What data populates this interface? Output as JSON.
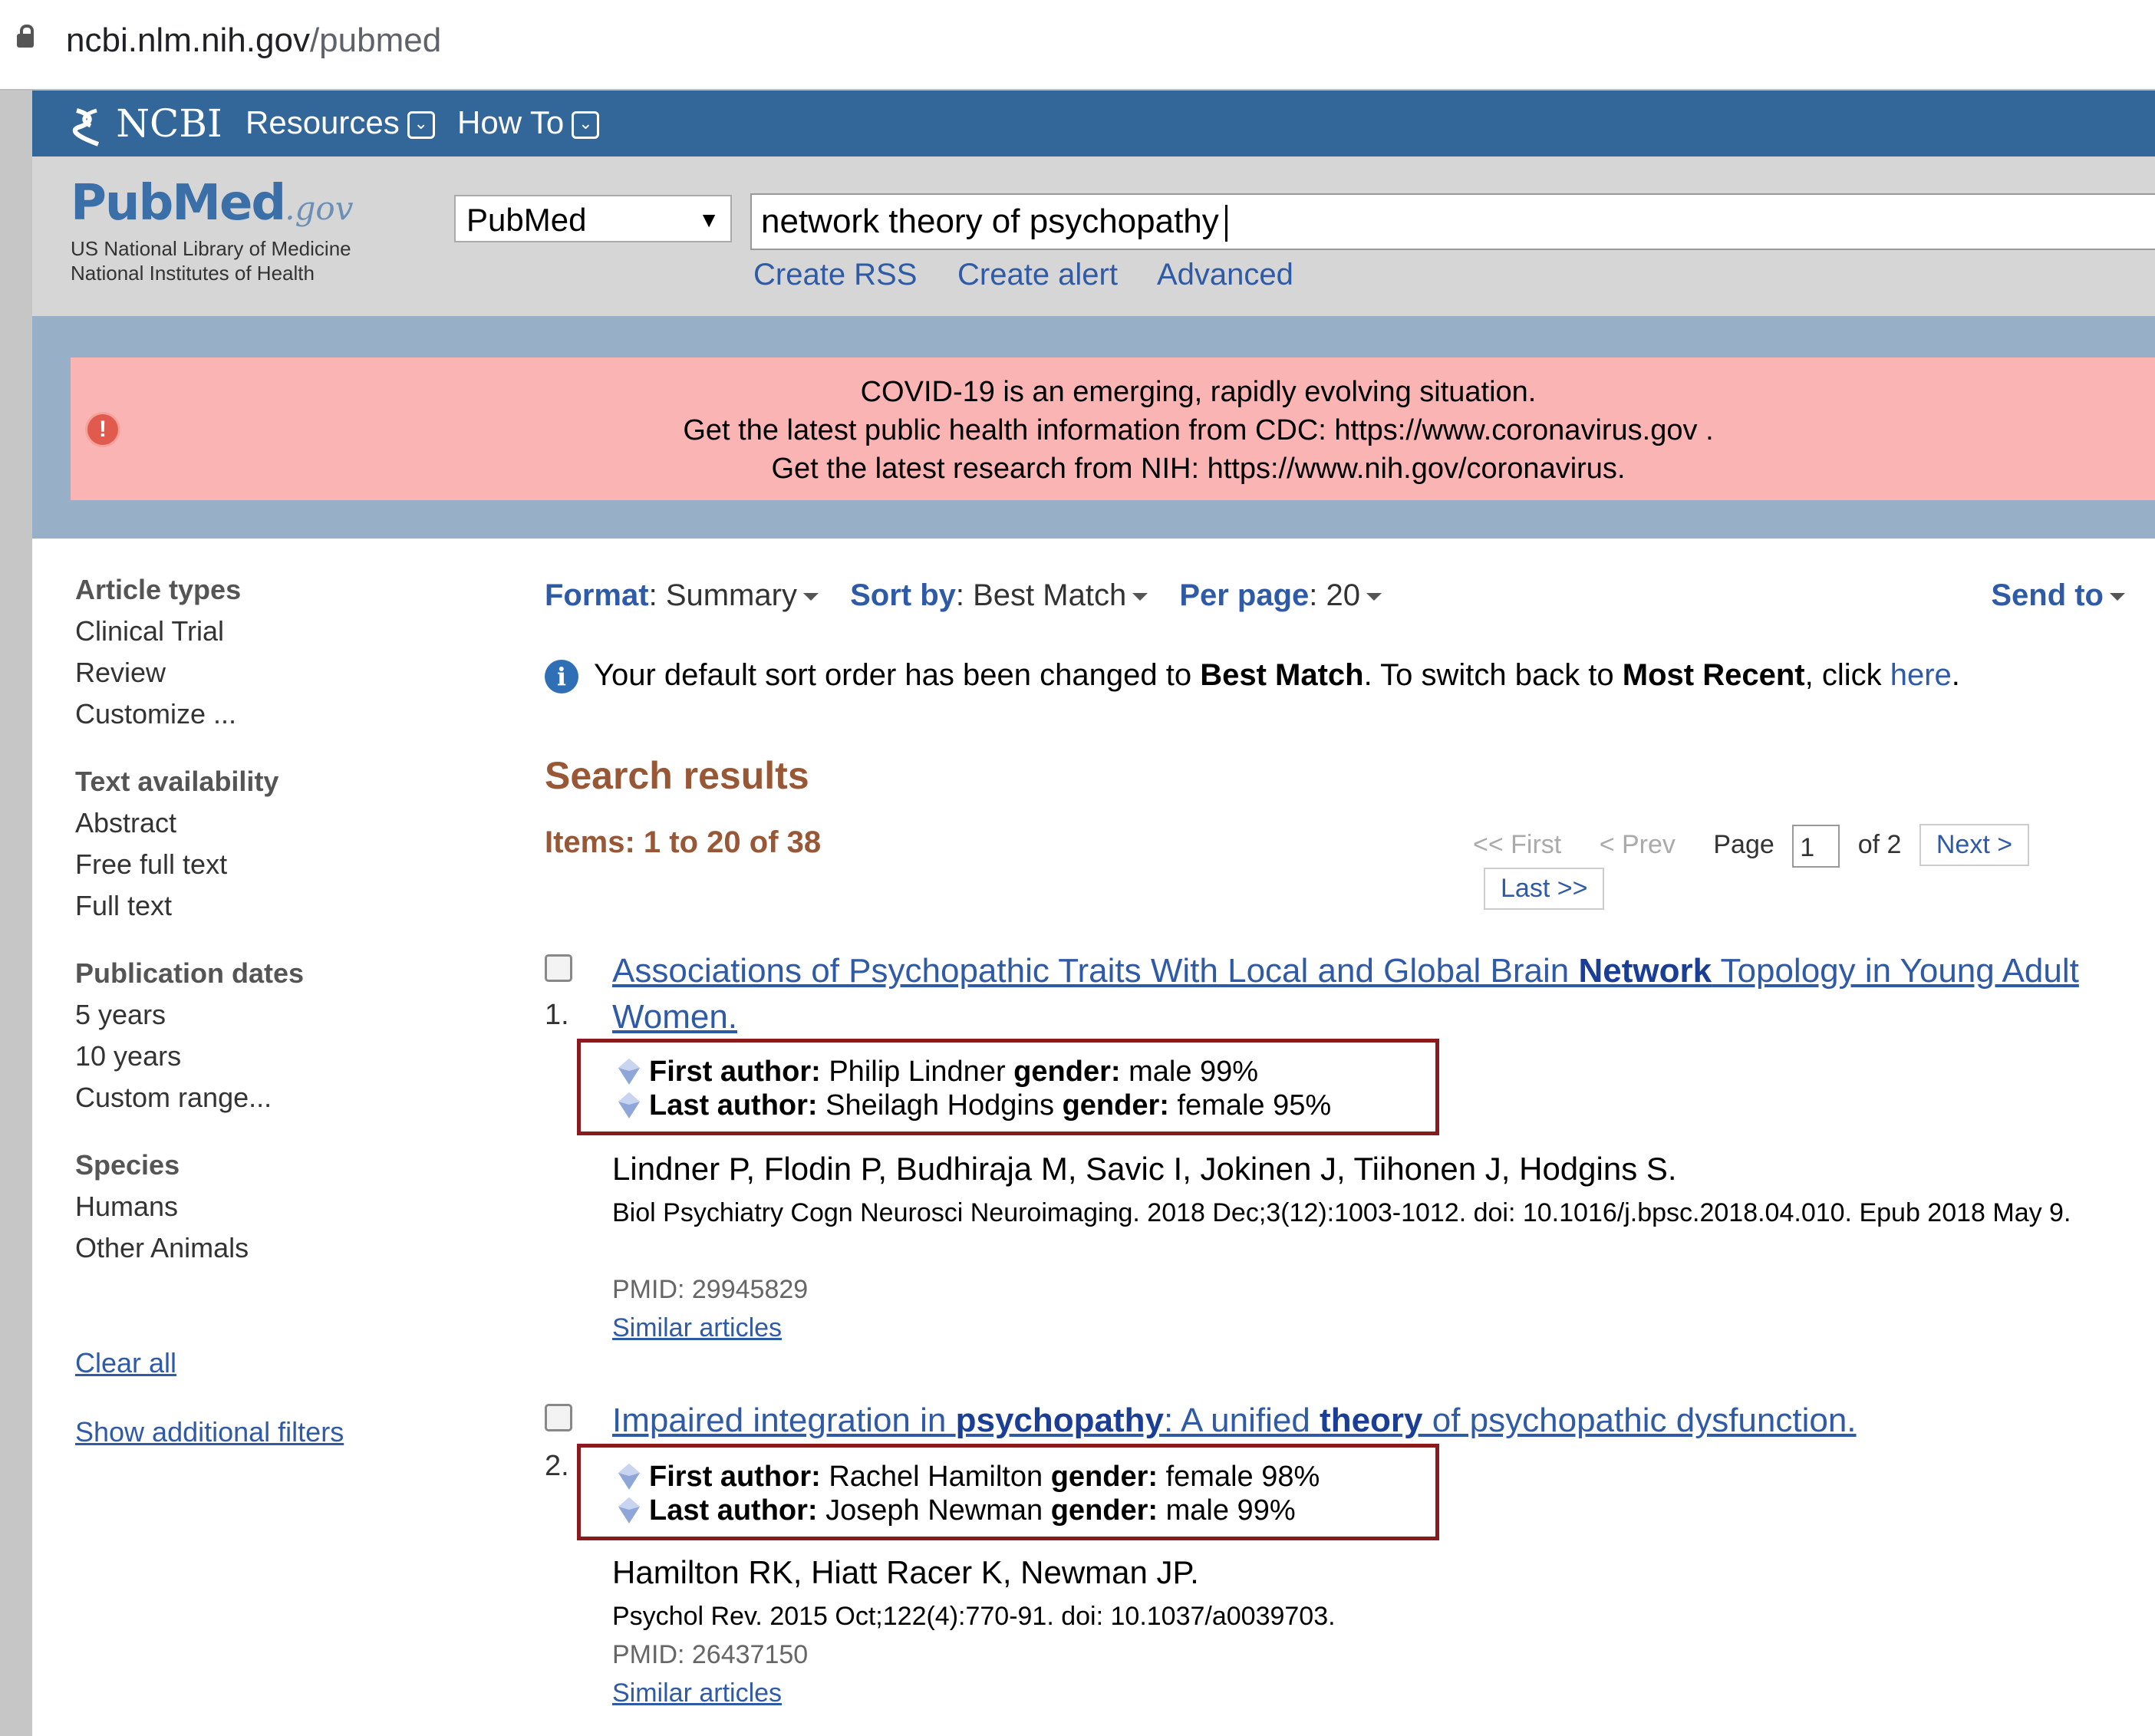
{
  "browser": {
    "url_host": "ncbi.nlm.nih.gov",
    "url_path": "/pubmed"
  },
  "ncbi_bar": {
    "logo": "NCBI",
    "menu": [
      "Resources",
      "How To"
    ]
  },
  "pubmed": {
    "logo_word": "PubMed",
    "logo_suffix": ".gov",
    "org_line1": "US National Library of Medicine",
    "org_line2": "National Institutes of Health",
    "database": "PubMed",
    "query": "network theory of psychopathy",
    "links": [
      "Create RSS",
      "Create alert",
      "Advanced"
    ]
  },
  "banner": {
    "line1": "COVID-19 is an emerging, rapidly evolving situation.",
    "line2_prefix": "Get the latest public health information from CDC: ",
    "line2_link": "https://www.coronavirus.gov ",
    "line2_suffix": ".",
    "line3_prefix": "Get the latest research from NIH: ",
    "line3_link": "https://www.nih.gov/coronavirus",
    "line3_suffix": "."
  },
  "sidebar": {
    "groups": [
      {
        "heading": "Article types",
        "items": [
          "Clinical Trial",
          "Review",
          "Customize ..."
        ]
      },
      {
        "heading": "Text availability",
        "items": [
          "Abstract",
          "Free full text",
          "Full text"
        ]
      },
      {
        "heading": "Publication dates",
        "items": [
          "5 years",
          "10 years",
          "Custom range..."
        ]
      },
      {
        "heading": "Species",
        "items": [
          "Humans",
          "Other Animals"
        ]
      }
    ],
    "clear_all": "Clear all",
    "show_filters": "Show additional filters"
  },
  "toolbar": {
    "format_label": "Format",
    "format_value": "Summary",
    "sort_label": "Sort by",
    "sort_value": "Best Match",
    "perpage_label": "Per page",
    "perpage_value": "20",
    "send_to": "Send to"
  },
  "notice": {
    "t1": "Your default sort order has been changed to ",
    "b1": "Best Match",
    "t2": ". To switch back to ",
    "b2": "Most Recent",
    "t3": ", click ",
    "link": "here",
    "t4": "."
  },
  "results_header": {
    "title": "Search results",
    "items": "Items: 1 to 20 of 38"
  },
  "pager": {
    "first": "<< First",
    "prev": "< Prev",
    "page_label": "Page",
    "page": "1",
    "of": "of 2",
    "next": "Next >",
    "last": "Last >>"
  },
  "results": [
    {
      "num": "1.",
      "title_a": "Associations of Psychopathic Traits With Local and Global Brain ",
      "title_b": "Network",
      "title_c": " Topology in Young Adult",
      "title_d": "Women.",
      "first_label": "First author:",
      "first_name": " Philip Lindner ",
      "first_glabel": "gender:",
      "first_gender": " male 99%",
      "last_label": "Last author:",
      "last_name": " Sheilagh Hodgins ",
      "last_glabel": "gender:",
      "last_gender": " female 95%",
      "authors": "Lindner P, Flodin P, Budhiraja M, Savic I, Jokinen J, Tiihonen J, Hodgins S.",
      "citation": "Biol Psychiatry Cogn Neurosci Neuroimaging. 2018 Dec;3(12):1003-1012. doi: 10.1016/j.bpsc.2018.04.010. Epub 2018 May 9.",
      "pmid": "PMID: 29945829",
      "similar": "Similar articles"
    },
    {
      "num": "2.",
      "title_a": "Impaired integration in ",
      "title_b": "psychopathy",
      "title_c": ": A unified ",
      "title_d": "theory",
      "title_e": " of psychopathic dysfunction.",
      "first_label": "First author:",
      "first_name": " Rachel Hamilton ",
      "first_glabel": "gender:",
      "first_gender": " female 98%",
      "last_label": "Last author:",
      "last_name": " Joseph Newman ",
      "last_glabel": "gender:",
      "last_gender": " male 99%",
      "authors": "Hamilton RK, Hiatt Racer K, Newman JP.",
      "citation": "Psychol Rev. 2015 Oct;122(4):770-91. doi: 10.1037/a0039703.",
      "pmid": "PMID: 26437150",
      "similar": "Similar articles"
    }
  ],
  "colors": {
    "ncbi_blue": "#336699",
    "banner_pink": "#fbb4b4",
    "highlight_box": "#8b1a1f",
    "heading_brown": "#985735"
  }
}
